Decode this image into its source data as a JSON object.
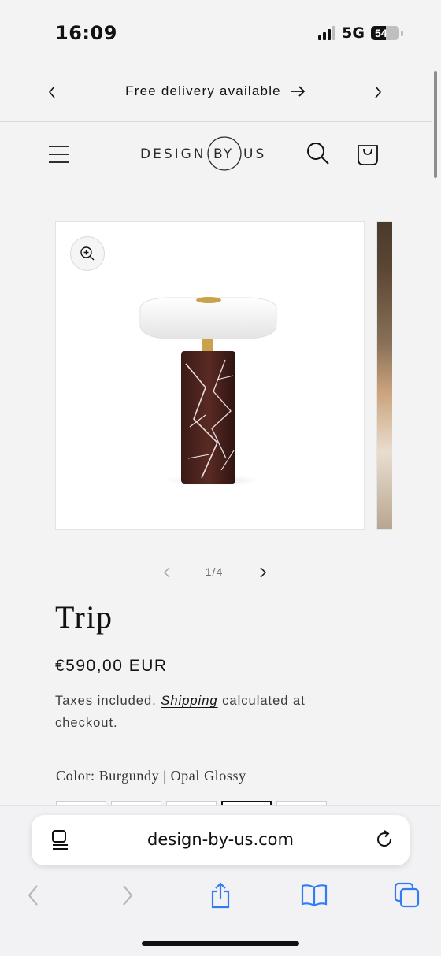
{
  "status": {
    "time": "16:09",
    "network": "5G",
    "battery": "54",
    "battery_level": 0.54
  },
  "announcement": {
    "text": "Free delivery available"
  },
  "header": {
    "logo_text": "DESIGN BY US"
  },
  "gallery": {
    "counter": "1/4",
    "current": 1,
    "total": 4
  },
  "product": {
    "title": "Trip",
    "price": "€590,00 EUR",
    "tax_prefix": "Taxes included.",
    "shipping_link": "Shipping",
    "tax_suffix": "calculated at checkout.",
    "color_label": "Color: Burgundy | Opal Glossy",
    "selected_swatch_index": 3
  },
  "browser": {
    "url": "design-by-us.com",
    "tint": "#2f7cf6"
  },
  "icons": [
    "chevron-left-icon",
    "arrow-right-icon",
    "chevron-right-icon",
    "hamburger-menu-icon",
    "search-icon",
    "cart-icon",
    "zoom-in-icon",
    "reader-icon",
    "reload-icon",
    "back-icon",
    "forward-icon",
    "share-icon",
    "bookmarks-icon",
    "tabs-icon"
  ]
}
